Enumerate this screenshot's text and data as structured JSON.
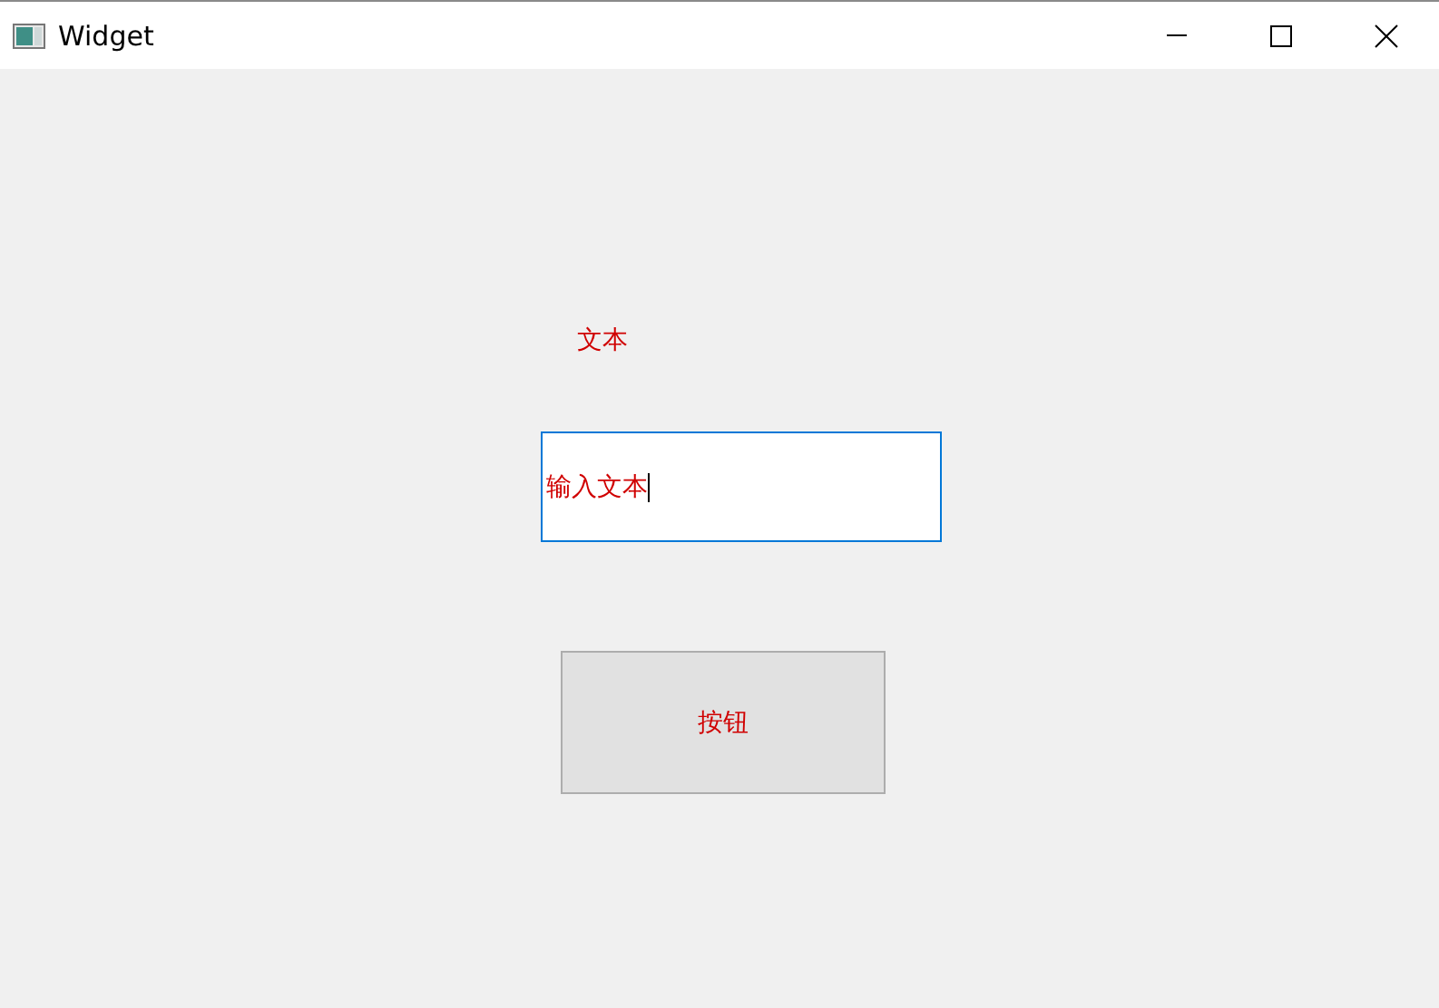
{
  "window": {
    "title": "Widget"
  },
  "label": {
    "text": "文本"
  },
  "input": {
    "value": "输入文本",
    "focused": true
  },
  "button": {
    "label": "按钮"
  }
}
